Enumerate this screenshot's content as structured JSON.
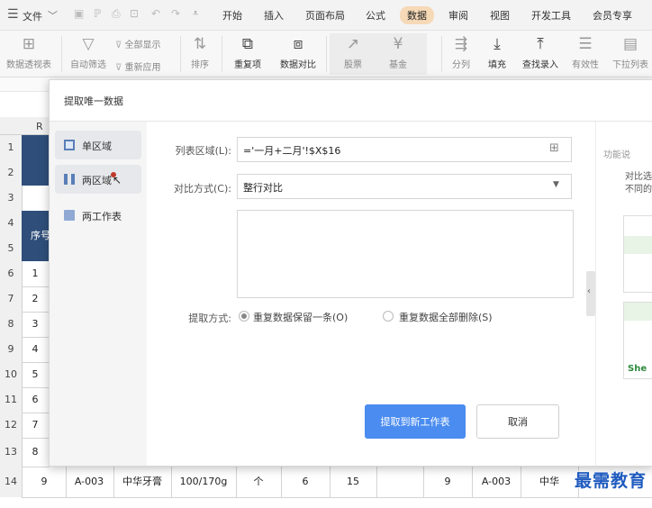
{
  "menubar": {
    "hamburger_icon": "hamburger-icon",
    "file_label": "文件",
    "tabs": [
      {
        "label": "开始"
      },
      {
        "label": "插入"
      },
      {
        "label": "页面布局"
      },
      {
        "label": "公式"
      },
      {
        "label": "数据"
      },
      {
        "label": "审阅"
      },
      {
        "label": "视图"
      },
      {
        "label": "开发工具"
      },
      {
        "label": "会员专享"
      }
    ],
    "active_tab_color": "#f6d9b7"
  },
  "ribbon": {
    "items": [
      {
        "label": "数据透视表"
      },
      {
        "label": "自动筛选"
      },
      {
        "label": "全部显示"
      },
      {
        "label": "重新应用"
      },
      {
        "label": "排序"
      },
      {
        "label": "重复项"
      },
      {
        "label": "数据对比"
      },
      {
        "label": "股票"
      },
      {
        "label": "基金"
      },
      {
        "label": "分列"
      },
      {
        "label": "填充"
      },
      {
        "label": "查找录入"
      },
      {
        "label": "有效性"
      },
      {
        "label": "下拉列表"
      }
    ]
  },
  "sheet": {
    "col_letter_r": "R",
    "header_cell": "序号",
    "row_numbers": [
      "1",
      "2",
      "3",
      "4",
      "5",
      "6",
      "7",
      "8",
      "9",
      "10",
      "11",
      "12",
      "13",
      "14"
    ],
    "seq_values": [
      "1",
      "2",
      "3",
      "4",
      "5",
      "6",
      "7",
      "8",
      "9"
    ],
    "row14": [
      "9",
      "A-003",
      "中华牙膏",
      "100/170g",
      "个",
      "6",
      "15",
      "",
      "9",
      "A-003",
      "中华"
    ],
    "right_sheet_label": "She"
  },
  "dialog": {
    "title": "提取唯一数据",
    "side_items": [
      {
        "label": "单区域"
      },
      {
        "label": "两区域"
      },
      {
        "label": "两工作表"
      }
    ],
    "range_label": "列表区域(L):",
    "range_value": "='一月+二月'!$X$16",
    "compare_label": "对比方式(C):",
    "compare_value": "整行对比",
    "extract_label": "提取方式:",
    "radio_keep": "重复数据保留一条(O)",
    "radio_delete": "重复数据全部删除(S)",
    "primary_button": "提取到新工作表",
    "cancel_button": "取消",
    "right_pane_title": "功能说",
    "right_pane_line1": "对比选",
    "right_pane_line2": "不同的",
    "accent": "#4a8cf0"
  },
  "watermark": "最需教育"
}
